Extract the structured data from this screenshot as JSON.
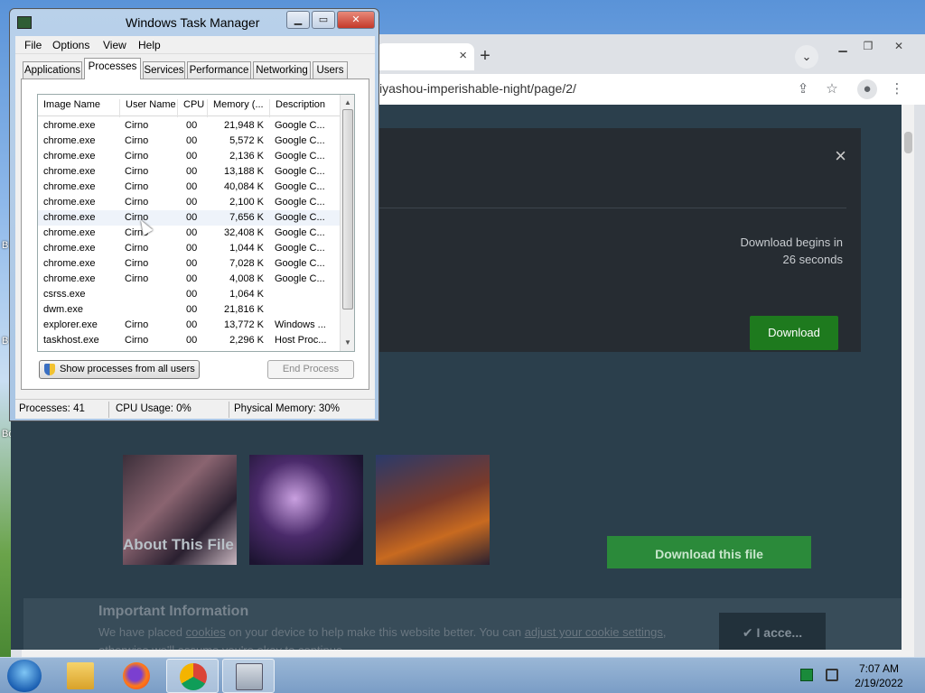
{
  "desktop": {
    "labels": [
      "B",
      "B",
      "Bo"
    ]
  },
  "browser": {
    "url_fragment": "iyashou-imperishable-night/page/2/",
    "tab_close": "×",
    "new_tab": "+",
    "dropdown": "⌄",
    "modal": {
      "close": "×",
      "message_line1": "Download begins in",
      "message_line2": "26 seconds",
      "download_label": "Download"
    },
    "about_title": "About This File",
    "download_file_label": "Download this file",
    "cookie": {
      "title": "Important Information",
      "text_before": "We have placed ",
      "link1": "cookies",
      "text_mid": " on your device to help make this website better. You can ",
      "link2": "adjust your cookie settings",
      "text_after": ", otherwise we'll assume you're okay to continue.",
      "accept_label": "✔  I acce..."
    }
  },
  "taskmgr": {
    "title": "Windows Task Manager",
    "menu": [
      "File",
      "Options",
      "View",
      "Help"
    ],
    "tabs": [
      "Applications",
      "Processes",
      "Services",
      "Performance",
      "Networking",
      "Users"
    ],
    "active_tab": "Processes",
    "columns": [
      "Image Name",
      "User Name",
      "CPU",
      "Memory (...",
      "Description"
    ],
    "rows": [
      {
        "image": "chrome.exe",
        "user": "Cirno",
        "cpu": "00",
        "mem": "21,948 K",
        "desc": "Google C..."
      },
      {
        "image": "chrome.exe",
        "user": "Cirno",
        "cpu": "00",
        "mem": "5,572 K",
        "desc": "Google C..."
      },
      {
        "image": "chrome.exe",
        "user": "Cirno",
        "cpu": "00",
        "mem": "2,136 K",
        "desc": "Google C..."
      },
      {
        "image": "chrome.exe",
        "user": "Cirno",
        "cpu": "00",
        "mem": "13,188 K",
        "desc": "Google C..."
      },
      {
        "image": "chrome.exe",
        "user": "Cirno",
        "cpu": "00",
        "mem": "40,084 K",
        "desc": "Google C..."
      },
      {
        "image": "chrome.exe",
        "user": "Cirno",
        "cpu": "00",
        "mem": "2,100 K",
        "desc": "Google C..."
      },
      {
        "image": "chrome.exe",
        "user": "Cirno",
        "cpu": "00",
        "mem": "7,656 K",
        "desc": "Google C..."
      },
      {
        "image": "chrome.exe",
        "user": "Cirno",
        "cpu": "00",
        "mem": "32,408 K",
        "desc": "Google C..."
      },
      {
        "image": "chrome.exe",
        "user": "Cirno",
        "cpu": "00",
        "mem": "1,044 K",
        "desc": "Google C..."
      },
      {
        "image": "chrome.exe",
        "user": "Cirno",
        "cpu": "00",
        "mem": "7,028 K",
        "desc": "Google C..."
      },
      {
        "image": "chrome.exe",
        "user": "Cirno",
        "cpu": "00",
        "mem": "4,008 K",
        "desc": "Google C..."
      },
      {
        "image": "csrss.exe",
        "user": "",
        "cpu": "00",
        "mem": "1,064 K",
        "desc": ""
      },
      {
        "image": "dwm.exe",
        "user": "",
        "cpu": "00",
        "mem": "21,816 K",
        "desc": ""
      },
      {
        "image": "explorer.exe",
        "user": "Cirno",
        "cpu": "00",
        "mem": "13,772 K",
        "desc": "Windows ..."
      },
      {
        "image": "taskhost.exe",
        "user": "Cirno",
        "cpu": "00",
        "mem": "2,296 K",
        "desc": "Host Proc..."
      }
    ],
    "show_all_label": "Show processes from all users",
    "end_process_label": "End Process",
    "status": {
      "processes": "Processes: 41",
      "cpu": "CPU Usage: 0%",
      "memory": "Physical Memory: 30%"
    }
  },
  "taskbar": {
    "time": "7:07 AM",
    "date": "2/19/2022"
  },
  "colors": {
    "download_green": "#1e7a1e",
    "page_bg": "#2b3f4c",
    "taskbar": "#7a9dc6"
  }
}
